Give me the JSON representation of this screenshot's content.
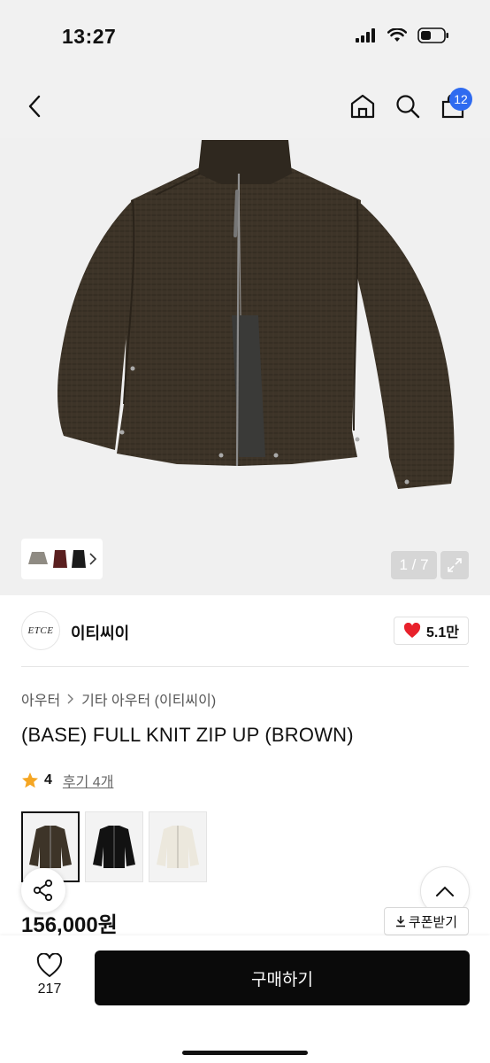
{
  "status_bar": {
    "time": "13:27",
    "icons": [
      "signal-icon",
      "wifi-icon",
      "battery-icon"
    ]
  },
  "nav": {
    "icons": [
      "back-arrow-icon",
      "home-icon",
      "search-icon",
      "shopping-bag-icon"
    ],
    "cart_badge": "12"
  },
  "gallery": {
    "counter": "1 / 7",
    "thumbnail_icons": [
      "jacket-grey-thumb",
      "jacket-red-thumb",
      "jacket-black-thumb"
    ]
  },
  "brand": {
    "logo_text": "ETCE",
    "name": "이티씨이",
    "likes": "5.1만"
  },
  "breadcrumb": {
    "category": "아우터",
    "subcategory": "기타 아우터 (이티씨이)"
  },
  "product": {
    "title": "(BASE) FULL KNIT ZIP UP (BROWN)",
    "rating": "4",
    "reviews_label": "후기 4개",
    "price": "156,000원",
    "color_options": [
      "brown",
      "black",
      "ivory"
    ]
  },
  "actions": {
    "coupon_label": "쿠폰받기",
    "wish_count": "217",
    "buy_label": "구매하기"
  },
  "colors": {
    "accent_badge": "#2f6bf0",
    "star": "#f5a623",
    "heart": "#e8212b",
    "buy_button": "#0a0a0a"
  }
}
